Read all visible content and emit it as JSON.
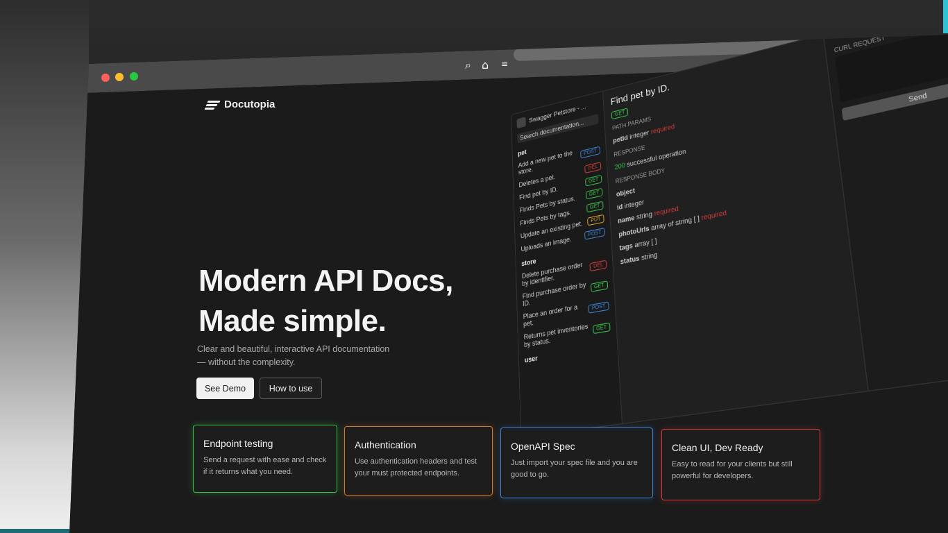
{
  "brand": {
    "name": "Docutopia"
  },
  "hero": {
    "title_line1": "Modern API Docs,",
    "title_line2": "Made simple.",
    "subtitle_line1": "Clear and beautiful, interactive API documentation",
    "subtitle_line2": "— without the complexity."
  },
  "buttons": {
    "demo": "See Demo",
    "how": "How to use"
  },
  "features": [
    {
      "title": "Endpoint testing",
      "desc": "Send a request with ease and check if it returns what you need."
    },
    {
      "title": "Authentication",
      "desc": "Use authentication headers and test your must protected endpoints."
    },
    {
      "title": "OpenAPI Spec",
      "desc": "Just import your spec file and you are good to go."
    },
    {
      "title": "Clean UI, Dev Ready",
      "desc": "Easy to read for your clients but still powerful for developers."
    }
  ],
  "preview": {
    "app_name": "Swagger Petstore - ...",
    "search_placeholder": "Search documentation...",
    "groups": [
      {
        "name": "pet",
        "items": [
          {
            "label": "Add a new pet to the store.",
            "method": "POST"
          },
          {
            "label": "Deletes a pet.",
            "method": "DEL"
          },
          {
            "label": "Find pet by ID.",
            "method": "GET"
          },
          {
            "label": "Finds Pets by status.",
            "method": "GET"
          },
          {
            "label": "Finds Pets by tags.",
            "method": "GET"
          },
          {
            "label": "Update an existing pet.",
            "method": "PUT"
          },
          {
            "label": "Uploads an image.",
            "method": "POST"
          }
        ]
      },
      {
        "name": "store",
        "items": [
          {
            "label": "Delete purchase order by identifier.",
            "method": "DEL"
          },
          {
            "label": "Find purchase order by ID.",
            "method": "GET"
          },
          {
            "label": "Place an order for a pet.",
            "method": "POST"
          },
          {
            "label": "Returns pet inventories by status.",
            "method": "GET"
          }
        ]
      },
      {
        "name": "user",
        "items": []
      }
    ],
    "endpoint_title": "Find pet by ID.",
    "path_params_label": "PATH PARAMS",
    "param_name": "petId",
    "param_type": "integer",
    "param_required": "required",
    "response_label": "RESPONSE",
    "response_code": "200",
    "response_desc": "successful operation",
    "response_body_label": "RESPONSE BODY",
    "fields": [
      {
        "name": "object",
        "type": ""
      },
      {
        "name": "id",
        "type": "integer"
      },
      {
        "name": "name",
        "type": "string",
        "required": "required"
      },
      {
        "name": "photoUrls",
        "type": "array of string [ ]",
        "required": "required"
      },
      {
        "name": "tags",
        "type": "array [ ]"
      },
      {
        "name": "status",
        "type": "string"
      }
    ],
    "right_title": "CURL REQUEST",
    "send_label": "Send"
  },
  "colors": {
    "endpoint_card": "#35c046",
    "auth_card": "#d27a2c",
    "openapi_card": "#3b82d6",
    "cleanui_card": "#d23b3b"
  }
}
